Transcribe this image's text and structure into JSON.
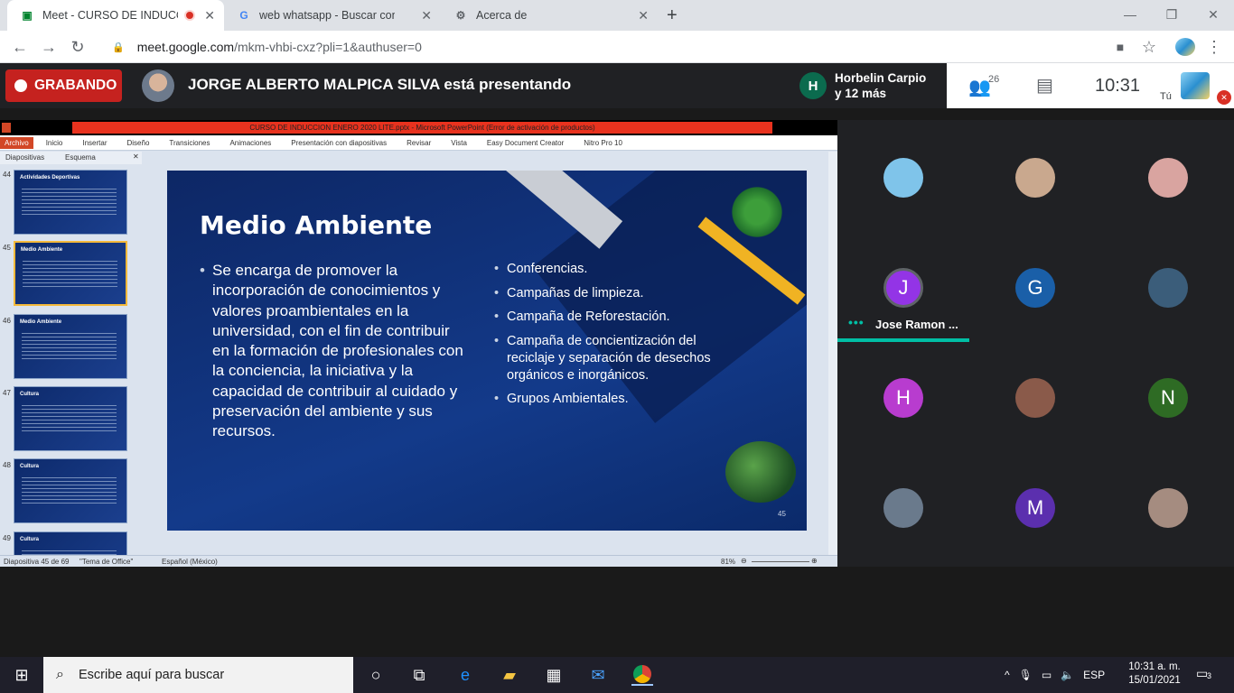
{
  "browser": {
    "tabs": [
      {
        "title": "Meet - CURSO DE INDUCCIÓ",
        "icon": "meet-icon",
        "recording": true
      },
      {
        "title": "web whatsapp - Buscar con Goo",
        "icon": "google-icon"
      },
      {
        "title": "Acerca de",
        "icon": "gear-icon"
      }
    ],
    "url_domain": "meet.google.com",
    "url_path": "/mkm-vhbi-cxz?pli=1&authuser=0"
  },
  "meet": {
    "recording_label": "GRABANDO",
    "presenting_text": "JORGE ALBERTO MALPICA SILVA está presentando",
    "participant_chip_initial": "H",
    "participant_chip_line1": "Horbelin Carpio",
    "participant_chip_line2": "y 12 más",
    "people_count": "26",
    "time": "10:31",
    "self_label": "Tú",
    "pinned_name": "Jose Ramon ..."
  },
  "tiles": [
    {
      "initial": "",
      "color": "#7fc4ea"
    },
    {
      "initial": "",
      "color": "#c9a88e"
    },
    {
      "initial": "",
      "color": "#d9a4a0"
    },
    {
      "initial": "J",
      "color": "#9334e6"
    },
    {
      "initial": "G",
      "color": "#1a5fa8"
    },
    {
      "initial": "",
      "color": "#3b5d7a"
    },
    {
      "initial": "H",
      "color": "#b83ccf"
    },
    {
      "initial": "",
      "color": "#8a5a4a"
    },
    {
      "initial": "N",
      "color": "#2e6b24"
    },
    {
      "initial": "",
      "color": "#6a7a8c"
    },
    {
      "initial": "M",
      "color": "#5b2fae"
    },
    {
      "initial": "",
      "color": "#a58c80"
    }
  ],
  "powerpoint": {
    "window_title": "CURSO DE INDUCCION ENERO 2020 LITE.pptx - Microsoft PowerPoint (Error de activación de productos)",
    "ribbon": [
      "Archivo",
      "Inicio",
      "Insertar",
      "Diseño",
      "Transiciones",
      "Animaciones",
      "Presentación con diapositivas",
      "Revisar",
      "Vista",
      "Easy Document Creator",
      "Nitro Pro 10"
    ],
    "pane_tabs": [
      "Diapositivas",
      "Esquema"
    ],
    "thumbs": [
      {
        "num": "44",
        "title": "Actividades Deportivas"
      },
      {
        "num": "45",
        "title": "Medio Ambiente"
      },
      {
        "num": "46",
        "title": "Medio Ambiente"
      },
      {
        "num": "47",
        "title": "Cultura"
      },
      {
        "num": "48",
        "title": "Cultura"
      },
      {
        "num": "49",
        "title": "Cultura"
      }
    ],
    "status_slide": "Diapositiva 45 de 69",
    "status_theme": "\"Tema de Office\"",
    "status_lang": "Español (México)",
    "zoom": "81%"
  },
  "slide": {
    "title": "Medio Ambiente",
    "left_text": "Se encarga de promover la incorporación de conocimientos y valores proambientales en la universidad, con el fin de contribuir en la formación de profesionales con la conciencia, la iniciativa y la capacidad de contribuir al cuidado y preservación del ambiente y sus recursos.",
    "right_items": [
      "Conferencias.",
      "Campañas de limpieza.",
      "Campaña de Reforestación.",
      "Campaña de concientización del reciclaje y separación de desechos orgánicos e inorgánicos.",
      "Grupos Ambientales."
    ],
    "number": "45"
  },
  "taskbar": {
    "search_placeholder": "Escribe aquí para buscar",
    "lang": "ESP",
    "time": "10:31 a. m.",
    "date": "15/01/2021",
    "notifications": "3"
  }
}
